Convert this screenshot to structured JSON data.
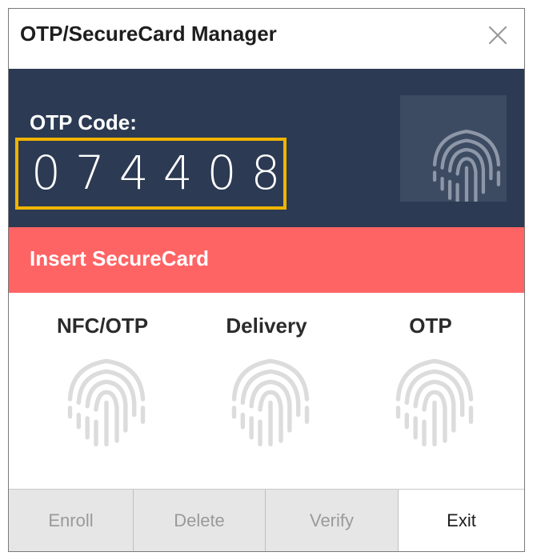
{
  "window": {
    "title": "OTP/SecureCard Manager"
  },
  "otp": {
    "label": "OTP Code:",
    "code": "074408"
  },
  "status": {
    "text": "Insert SecureCard",
    "color": "#ff6465"
  },
  "modes": [
    {
      "label": "NFC/OTP",
      "icon": "fingerprint-icon"
    },
    {
      "label": "Delivery",
      "icon": "fingerprint-icon"
    },
    {
      "label": "OTP",
      "icon": "fingerprint-icon"
    }
  ],
  "buttons": {
    "enroll": {
      "label": "Enroll",
      "enabled": false
    },
    "delete": {
      "label": "Delete",
      "enabled": false
    },
    "verify": {
      "label": "Verify",
      "enabled": false
    },
    "exit": {
      "label": "Exit",
      "enabled": true
    }
  },
  "colors": {
    "panel": "#2c3a53",
    "highlight": "#f0b400",
    "status": "#ff6465"
  }
}
